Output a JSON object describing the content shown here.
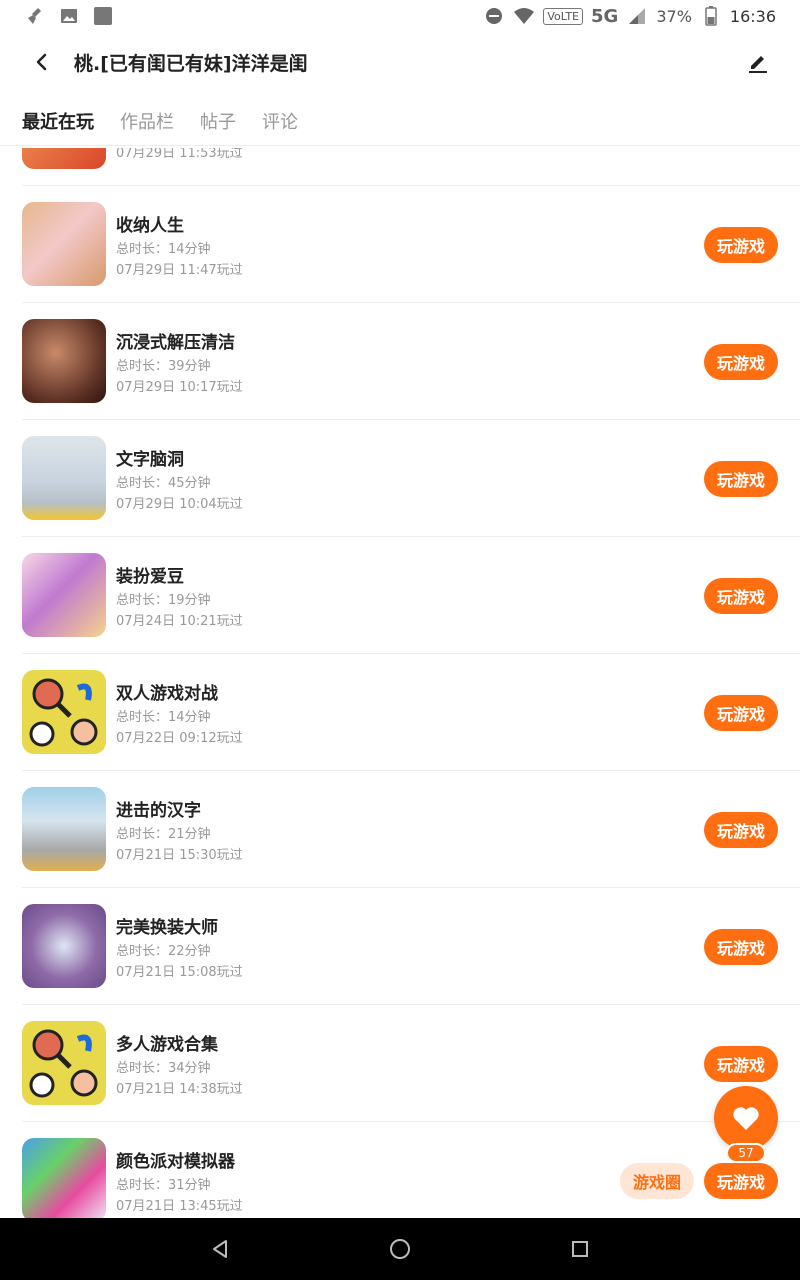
{
  "status_bar": {
    "network": "5G",
    "volte": "VoLTE",
    "battery": "37%",
    "time": "16:36"
  },
  "header": {
    "title": "桃.[已有闺已有妹]洋洋是闺"
  },
  "tabs": [
    {
      "label": "最近在玩",
      "active": true
    },
    {
      "label": "作品栏",
      "active": false
    },
    {
      "label": "帖子",
      "active": false
    },
    {
      "label": "评论",
      "active": false
    }
  ],
  "partial_row": {
    "last_played": "07月29日 11:53玩过"
  },
  "games": [
    {
      "name": "收纳人生",
      "duration": "总时长：14分钟",
      "last_played": "07月29日 11:47玩过",
      "play_label": "玩游戏"
    },
    {
      "name": "沉浸式解压清洁",
      "duration": "总时长：39分钟",
      "last_played": "07月29日 10:17玩过",
      "play_label": "玩游戏"
    },
    {
      "name": "文字脑洞",
      "duration": "总时长：45分钟",
      "last_played": "07月29日 10:04玩过",
      "play_label": "玩游戏"
    },
    {
      "name": "装扮爱豆",
      "duration": "总时长：19分钟",
      "last_played": "07月24日 10:21玩过",
      "play_label": "玩游戏"
    },
    {
      "name": "双人游戏对战",
      "duration": "总时长：14分钟",
      "last_played": "07月22日 09:12玩过",
      "play_label": "玩游戏"
    },
    {
      "name": "进击的汉字",
      "duration": "总时长：21分钟",
      "last_played": "07月21日 15:30玩过",
      "play_label": "玩游戏"
    },
    {
      "name": "完美换装大师",
      "duration": "总时长：22分钟",
      "last_played": "07月21日 15:08玩过",
      "play_label": "玩游戏"
    },
    {
      "name": "多人游戏合集",
      "duration": "总时长：34分钟",
      "last_played": "07月21日 14:38玩过",
      "play_label": "玩游戏"
    },
    {
      "name": "颜色派对模拟器",
      "duration": "总时长：31分钟",
      "last_played": "07月21日 13:45玩过",
      "play_label": "玩游戏",
      "circle_label": "游戏圈"
    }
  ],
  "fab": {
    "count": "57"
  },
  "colors": {
    "accent": "#ff6f12",
    "accent_light": "#ffe6d4"
  }
}
